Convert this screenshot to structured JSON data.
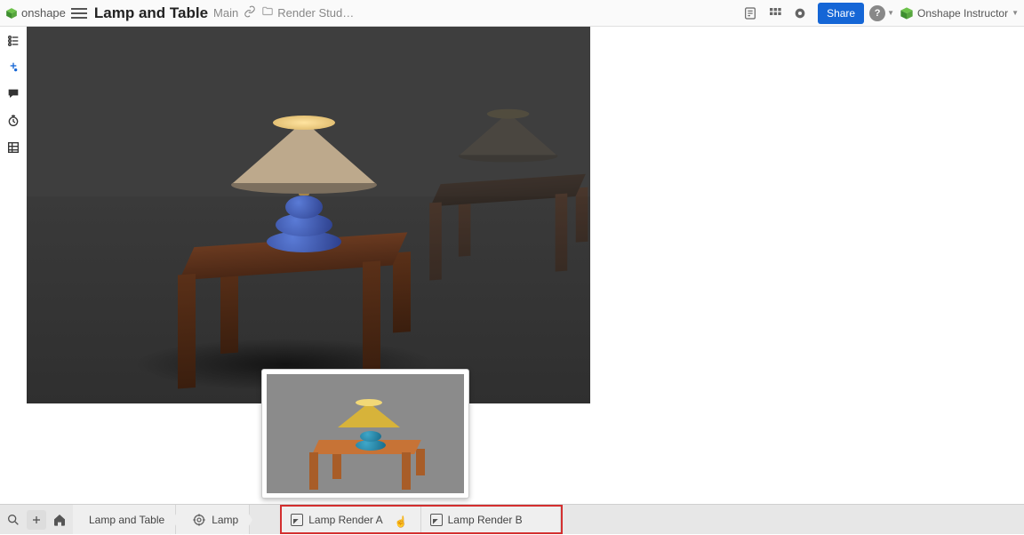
{
  "brand": "onshape",
  "doc_title": "Lamp and Table",
  "doc_branch": "Main",
  "folder_name": "Render Stud…",
  "share_label": "Share",
  "user_name": "Onshape Instructor",
  "bottom": {
    "tab1": "Lamp and Table",
    "tab2": "Lamp",
    "render_a": "Lamp Render A",
    "render_b": "Lamp Render B"
  }
}
